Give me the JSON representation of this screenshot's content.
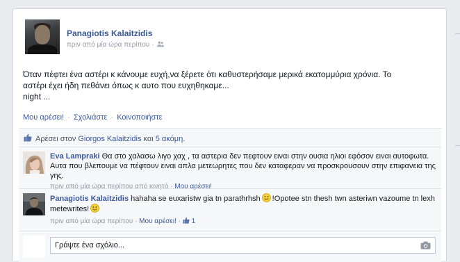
{
  "post": {
    "author": "Panagiotis Kalaitzidis",
    "time": "πριν από μία ώρα περίπου",
    "separator": "·",
    "text_lines": [
      "Όταν πέφτει ένα αστέρι κ κάνουμε ευχή,να ξέρετε ότι καθυστερήσαμε μερικά εκατομμύρια χρόνια. Το",
      "αστέρι έχει ήδη πεθάνει όπως κ αυτο που ευχηθηκαμε...",
      "night ..."
    ],
    "actions": {
      "like": "Μου αρέσει!",
      "comment": "Σχολιάστε",
      "share": "Κοινοποιήστε",
      "dot": "·"
    },
    "icons": {
      "audience": "friends-icon",
      "like": "thumbs-up-icon",
      "camera": "camera-icon",
      "emoji": "smiley-icon"
    }
  },
  "likes": {
    "prefix": "Αρέσει στον",
    "person": "Giorgos Kalaitzidis",
    "middle": "και",
    "others": "5 ακόμη",
    "suffix": "."
  },
  "comments": [
    {
      "author": "Eva Lampraki",
      "text": "Θα στο χαλασω λιγο χαχ , τα αστερια δεν πεφτουν ειναι στην ουσια ηλιοι εφόσον ειναι αυτοφωτα. Αυτα που βλεπουμε να πέφτουν ειναι απλα μετεωρητες που δεν καταφεραν να προσκρουσουν στην επιφανεια της γης.",
      "time": "πριν από μία ώρα περίπου από κινητό",
      "sep": "·",
      "like": "Μου αρέσει!"
    },
    {
      "author": "Panagiotis Kalaitzidis",
      "text_a": "hahaha se euxaristw gia tn parathrhsh",
      "text_b": "!Opotee stn thesh twn asteriwn vazoume tn lexh metewrites!",
      "time": "πριν από μία ώρα περίπου",
      "sep": "·",
      "like": "Μου αρέσει!",
      "sep2": "·",
      "like_count": "1"
    }
  ],
  "reply": {
    "placeholder": "Γράψτε ένα σχόλιο..."
  },
  "colors": {
    "link": "#3b5998",
    "meta": "#9197a3",
    "ufi_bg": "#f6f7f8",
    "page_bg": "#e9ebee"
  }
}
